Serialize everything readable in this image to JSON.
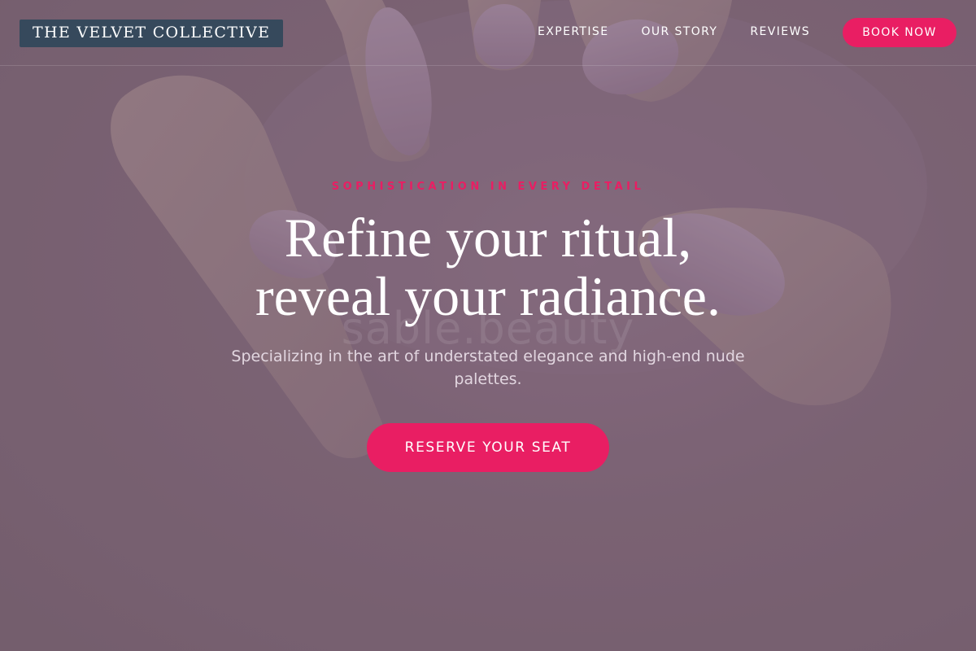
{
  "brand": {
    "name": "THE VELVET COLLECTIVE"
  },
  "nav": {
    "links": [
      {
        "label": "EXPERTISE"
      },
      {
        "label": "OUR STORY"
      },
      {
        "label": "REVIEWS"
      }
    ],
    "cta_label": "BOOK NOW"
  },
  "hero": {
    "eyebrow": "SOPHISTICATION IN EVERY DETAIL",
    "headline_line1": "Refine your ritual,",
    "headline_line2": "reveal your radiance.",
    "subtitle": "Specializing in the art of understated elegance and high-end nude palettes.",
    "cta_label": "RESERVE YOUR SEAT",
    "background_watermark": "sable.beauty"
  },
  "colors": {
    "accent": "#e91e63",
    "logo_background": "#36495c",
    "hero_background": "#7f6778",
    "text_primary": "#ffffff",
    "text_muted": "#e2d6e0"
  }
}
